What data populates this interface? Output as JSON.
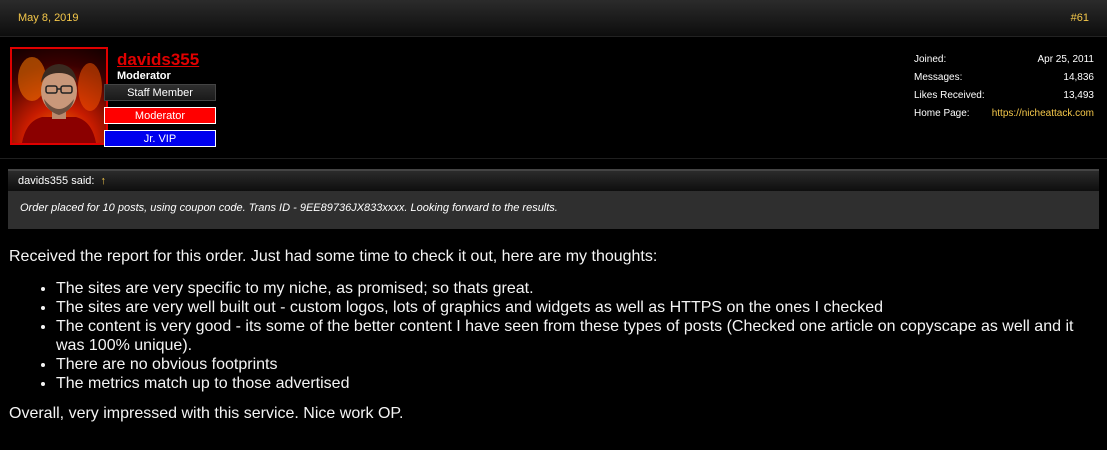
{
  "post": {
    "date": "May 8, 2019",
    "number": "#61"
  },
  "user": {
    "name": "davids355",
    "title": "Moderator",
    "banners": {
      "staff": "Staff Member",
      "moderator": "Moderator",
      "vip": "Jr. VIP"
    },
    "stats": {
      "joined_label": "Joined:",
      "joined_value": "Apr 25, 2011",
      "messages_label": "Messages:",
      "messages_value": "14,836",
      "likes_label": "Likes Received:",
      "likes_value": "13,493",
      "homepage_label": "Home Page:",
      "homepage_value": "https://nicheattack.com"
    }
  },
  "quote": {
    "author": "davids355 said:",
    "arrow": "↑",
    "text": "Order placed for 10 posts, using coupon code. Trans ID - 9EE89736JX833xxxx. Looking forward to the results."
  },
  "body": {
    "intro": "Received the report for this order. Just had some time to check it out, here are my thoughts:",
    "bullets": [
      "The sites are very specific to my niche, as promised; so thats great.",
      "The sites are very well built out - custom logos, lots of graphics and widgets as well as HTTPS on the ones I checked",
      "The content is very good - its some of the better content I have seen from these types of posts (Checked one article on copyscape as well and it was 100% unique).",
      "There are no obvious footprints",
      "The metrics match up to those advertised"
    ],
    "outro": "Overall, very impressed with this service. Nice work OP."
  }
}
